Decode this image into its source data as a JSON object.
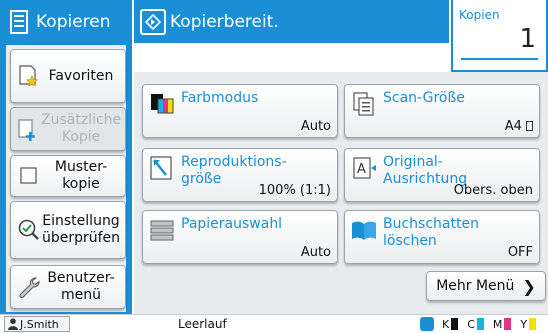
{
  "header": {
    "app_title": "Kopieren",
    "status": "Kopierbereit.",
    "copies_label": "Kopien",
    "copies_value": "1"
  },
  "sidebar": {
    "items": [
      {
        "label": "Favoriten",
        "icon": "star-document-icon"
      },
      {
        "label": "Zusätzliche Kopie",
        "icon": "add-copy-icon",
        "disabled": true
      },
      {
        "label": "Muster-kopie",
        "icon": "checkbox-icon"
      },
      {
        "label": "Einstellung überprüfen",
        "icon": "check-magnifier-icon"
      },
      {
        "label": "Benutzer-menü",
        "icon": "wrench-icon"
      }
    ]
  },
  "tiles": [
    {
      "title": "Farbmodus",
      "value": "Auto",
      "icon": "color-mode-icon"
    },
    {
      "title": "Scan-Größe",
      "value": "A4",
      "icon": "scan-size-icon"
    },
    {
      "title": "Reproduktions-größe",
      "value": "100% (1:1)",
      "icon": "reproduction-size-icon"
    },
    {
      "title": "Original-Ausrichtung",
      "value": "Obers. oben",
      "icon": "orientation-icon"
    },
    {
      "title": "Papierauswahl",
      "value": "Auto",
      "icon": "paper-tray-icon"
    },
    {
      "title": "Buchschatten löschen",
      "value": "OFF",
      "icon": "book-shadow-icon"
    }
  ],
  "more_menu": "Mehr Menü",
  "statusbar": {
    "user": "J.Smith",
    "message": "Leerlauf",
    "toner": [
      {
        "label": "K",
        "color": "#111111"
      },
      {
        "label": "C",
        "color": "#1ab0e8"
      },
      {
        "label": "M",
        "color": "#e0338a"
      },
      {
        "label": "Y",
        "color": "#f2e100"
      }
    ]
  },
  "colors": {
    "accent": "#1a8fd6"
  }
}
